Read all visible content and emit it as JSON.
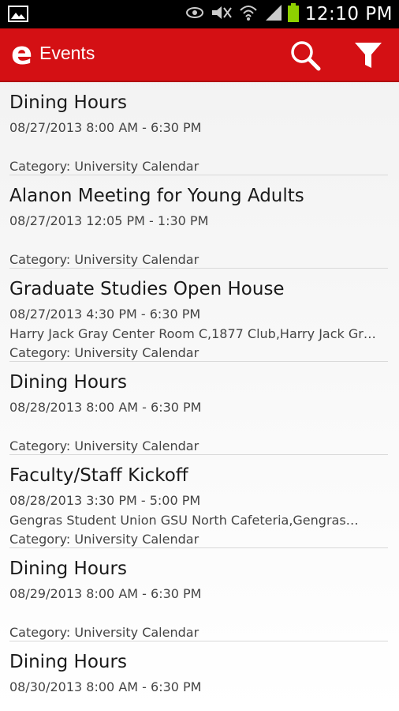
{
  "status_bar": {
    "time": "12:10 PM",
    "icons": [
      "picture-icon",
      "eye-icon",
      "mute-icon",
      "wifi-icon",
      "signal-icon",
      "battery-icon"
    ]
  },
  "action_bar": {
    "logo_glyph": "e",
    "title": "Events",
    "icons": [
      "search-icon",
      "filter-icon"
    ],
    "accent_color": "#d41014"
  },
  "events": [
    {
      "title": "Dining Hours",
      "date": "08/27/2013 8:00 AM - 6:30 PM",
      "location": "",
      "category": "Category: University Calendar"
    },
    {
      "title": "Alanon Meeting for Young Adults",
      "date": "08/27/2013 12:05 PM - 1:30 PM",
      "location": "",
      "category": "Category: University Calendar"
    },
    {
      "title": "Graduate Studies Open House",
      "date": "08/27/2013 4:30 PM - 6:30 PM",
      "location": "Harry Jack Gray Center Room C,1877 Club,Harry Jack Gr…",
      "category": "Category: University Calendar"
    },
    {
      "title": "Dining Hours",
      "date": "08/28/2013 8:00 AM - 6:30 PM",
      "location": "",
      "category": "Category: University Calendar"
    },
    {
      "title": "Faculty/Staff Kickoff",
      "date": "08/28/2013 3:30 PM - 5:00 PM",
      "location": "Gengras Student Union GSU North Cafeteria,Gengras…",
      "category": "Category: University Calendar"
    },
    {
      "title": "Dining Hours",
      "date": "08/29/2013 8:00 AM - 6:30 PM",
      "location": "",
      "category": "Category: University Calendar"
    },
    {
      "title": "Dining Hours",
      "date": "08/30/2013 8:00 AM - 6:30 PM",
      "location": "",
      "category": ""
    }
  ]
}
